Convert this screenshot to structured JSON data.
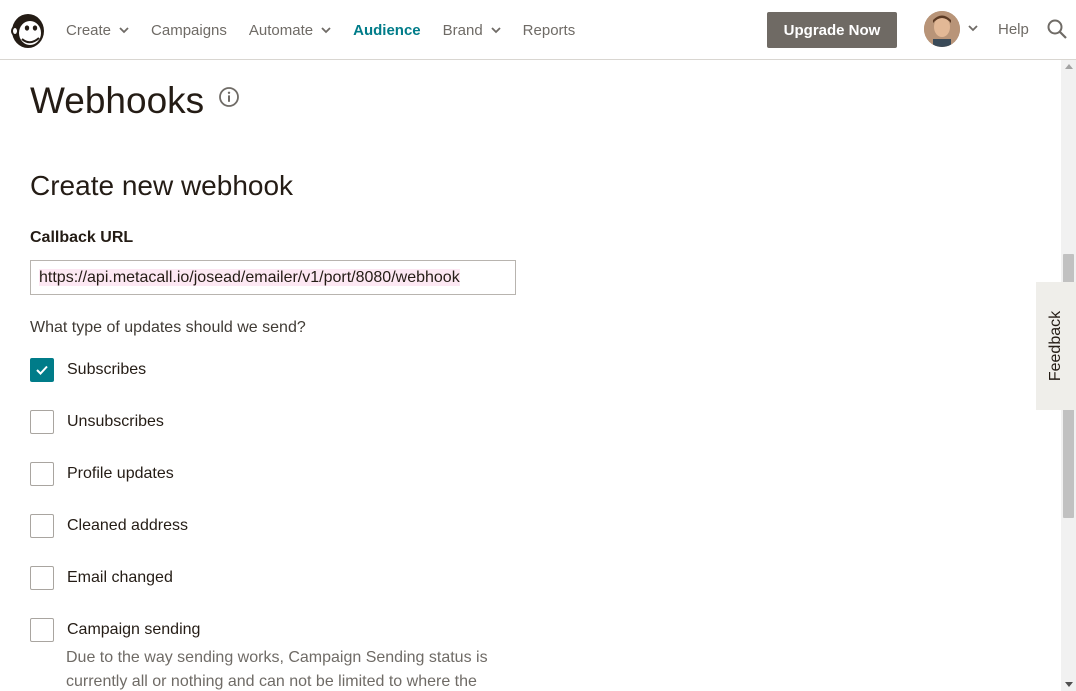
{
  "nav": {
    "items": [
      {
        "label": "Create",
        "has_chevron": true,
        "active": false
      },
      {
        "label": "Campaigns",
        "has_chevron": false,
        "active": false
      },
      {
        "label": "Automate",
        "has_chevron": true,
        "active": false
      },
      {
        "label": "Audience",
        "has_chevron": false,
        "active": true
      },
      {
        "label": "Brand",
        "has_chevron": true,
        "active": false
      },
      {
        "label": "Reports",
        "has_chevron": false,
        "active": false
      }
    ],
    "upgrade_label": "Upgrade Now",
    "help_label": "Help",
    "logo_icon": "mailchimp-logo-icon",
    "search_icon": "search-icon"
  },
  "page": {
    "title": "Webhooks",
    "section_title": "Create new webhook",
    "callback_label": "Callback URL",
    "callback_value": "https://api.metacall.io/josead/emailer/v1/port/8080/webhook",
    "question": "What type of updates should we send?",
    "options": [
      {
        "label": "Subscribes",
        "checked": true
      },
      {
        "label": "Unsubscribes",
        "checked": false
      },
      {
        "label": "Profile updates",
        "checked": false
      },
      {
        "label": "Cleaned address",
        "checked": false
      },
      {
        "label": "Email changed",
        "checked": false
      },
      {
        "label": "Campaign sending",
        "checked": false
      }
    ],
    "campaign_sending_desc": "Due to the way sending works, Campaign Sending status is currently all or nothing and can not be limited to where the"
  },
  "feedback_label": "Feedback",
  "colors": {
    "accent": "#007c89",
    "upgrade_bg": "#6f6a64",
    "text": "#241c15",
    "muted": "#6f6b66"
  }
}
